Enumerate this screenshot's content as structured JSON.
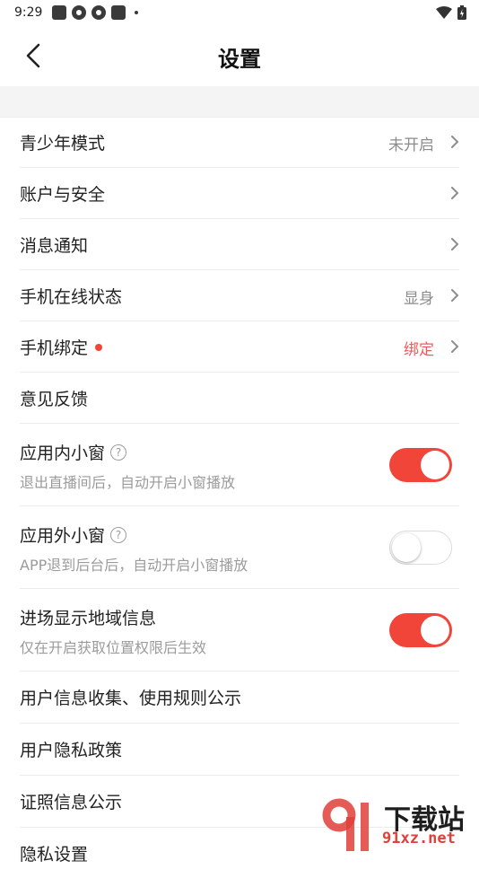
{
  "status_bar": {
    "time": "9:29"
  },
  "header": {
    "title": "设置"
  },
  "rows": [
    {
      "label": "青少年模式",
      "value": "未开启"
    },
    {
      "label": "账户与安全"
    },
    {
      "label": "消息通知"
    },
    {
      "label": "手机在线状态",
      "value": "显身"
    },
    {
      "label": "手机绑定",
      "value": "绑定"
    },
    {
      "label": "意见反馈"
    }
  ],
  "toggles": [
    {
      "label": "应用内小窗",
      "sub": "退出直播间后，自动开启小窗播放",
      "on": true
    },
    {
      "label": "应用外小窗",
      "sub": "APP退到后台后，自动开启小窗播放",
      "on": false
    },
    {
      "label": "进场显示地域信息",
      "sub": "仅在开启获取位置权限后生效",
      "on": true
    }
  ],
  "links": [
    {
      "label": "用户信息收集、使用规则公示"
    },
    {
      "label": "用户隐私政策"
    },
    {
      "label": "证照信息公示"
    },
    {
      "label": "隐私设置"
    }
  ],
  "watermark": {
    "text": "下载站",
    "sub": "91xz.net"
  },
  "colors": {
    "accent": "#f2453a",
    "value_red": "#f2585f"
  }
}
